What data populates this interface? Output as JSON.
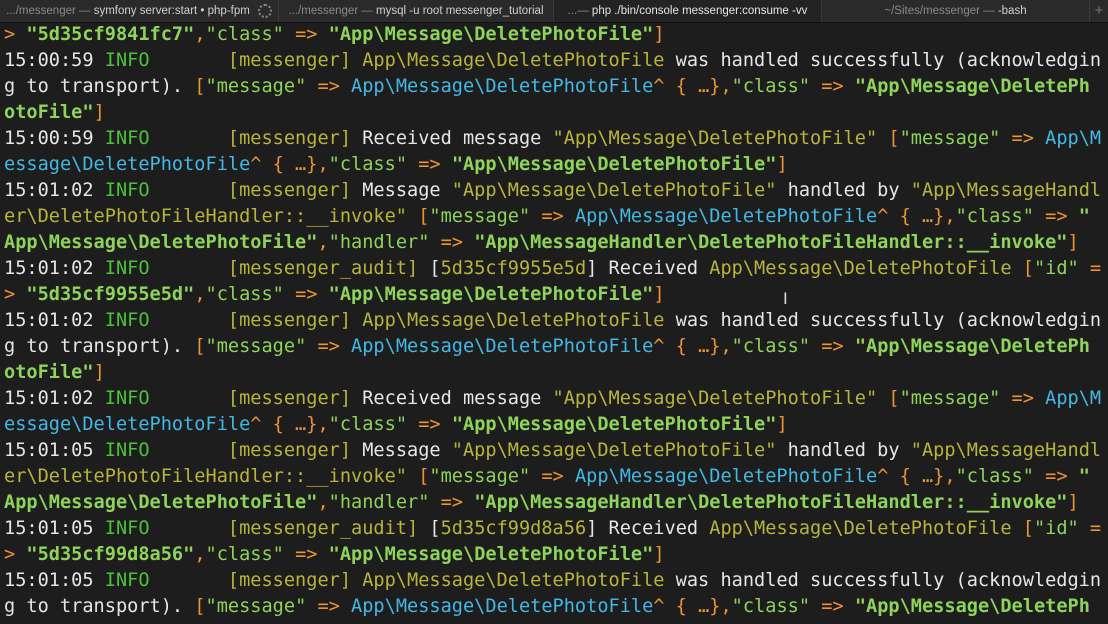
{
  "tabs": [
    {
      "path": ".../messenger — ",
      "cmd": "symfony server:start • php-fpm",
      "busy": true
    },
    {
      "path": ".../messenger — ",
      "cmd": "mysql -u root messenger_tutorial"
    },
    {
      "path": "...— ",
      "cmd": "php ./bin/console messenger:consume -vv",
      "active": true
    },
    {
      "path": "~/Sites/messenger — ",
      "cmd": "-bash"
    }
  ],
  "new_tab_label": "+",
  "colors": {
    "background": "#1d1d1d",
    "info": "#4cc13a",
    "channel": "#b9b43c",
    "punct": "#ec9435",
    "class": "#44b8e4",
    "string": "#8ed35a"
  },
  "lines": [
    [
      [
        "> ",
        "o"
      ],
      [
        "\"5d35cf9841fc7\"",
        "b"
      ],
      [
        ",",
        "o"
      ],
      [
        "\"class\"",
        "l"
      ],
      [
        " => ",
        "o"
      ],
      [
        "\"App\\Message\\DeletePhotoFile\"",
        "b"
      ],
      [
        "]",
        "o"
      ]
    ],
    [
      [
        "15:00:59 ",
        "w"
      ],
      [
        "INFO",
        "g"
      ],
      [
        "       [messenger] App\\Message\\DeletePhotoFile ",
        "y"
      ],
      [
        "was handled successfully (acknowledgin",
        "w"
      ]
    ],
    [
      [
        "g to transport). ",
        "w"
      ],
      [
        "[",
        "o"
      ],
      [
        "\"message\"",
        "l"
      ],
      [
        " => ",
        "o"
      ],
      [
        "App\\Message\\DeletePhotoFile",
        "c"
      ],
      [
        "^ { …},",
        "o"
      ],
      [
        "\"class\"",
        "l"
      ],
      [
        " => ",
        "o"
      ],
      [
        "\"App\\Message\\DeletePh",
        "b"
      ]
    ],
    [
      [
        "otoFile\"",
        "b"
      ],
      [
        "]",
        "o"
      ]
    ],
    [
      [
        "15:00:59 ",
        "w"
      ],
      [
        "INFO",
        "g"
      ],
      [
        "       [messenger] ",
        "y"
      ],
      [
        "Received message ",
        "w"
      ],
      [
        "\"App\\Message\\DeletePhotoFile\" ",
        "y"
      ],
      [
        "[",
        "o"
      ],
      [
        "\"message\"",
        "l"
      ],
      [
        " => ",
        "o"
      ],
      [
        "App\\M",
        "c"
      ]
    ],
    [
      [
        "essage\\DeletePhotoFile",
        "c"
      ],
      [
        "^ { …},",
        "o"
      ],
      [
        "\"class\"",
        "l"
      ],
      [
        " => ",
        "o"
      ],
      [
        "\"App\\Message\\DeletePhotoFile\"",
        "b"
      ],
      [
        "]",
        "o"
      ]
    ],
    [
      [
        "15:01:02 ",
        "w"
      ],
      [
        "INFO",
        "g"
      ],
      [
        "       [messenger] ",
        "y"
      ],
      [
        "Message ",
        "w"
      ],
      [
        "\"App\\Message\\DeletePhotoFile\"",
        "y"
      ],
      [
        " handled by ",
        "w"
      ],
      [
        "\"App\\MessageHandl",
        "y"
      ]
    ],
    [
      [
        "er\\DeletePhotoFileHandler::__invoke\" ",
        "y"
      ],
      [
        "[",
        "o"
      ],
      [
        "\"message\"",
        "l"
      ],
      [
        " => ",
        "o"
      ],
      [
        "App\\Message\\DeletePhotoFile",
        "c"
      ],
      [
        "^ { …},",
        "o"
      ],
      [
        "\"class\"",
        "l"
      ],
      [
        " => ",
        "o"
      ],
      [
        "\"",
        "b"
      ]
    ],
    [
      [
        "App\\Message\\DeletePhotoFile\"",
        "b"
      ],
      [
        ",",
        "o"
      ],
      [
        "\"handler\"",
        "l"
      ],
      [
        " => ",
        "o"
      ],
      [
        "\"App\\MessageHandler\\DeletePhotoFileHandler::__invoke\"",
        "b"
      ],
      [
        "]",
        "o"
      ]
    ],
    [
      [
        "15:01:02 ",
        "w"
      ],
      [
        "INFO",
        "g"
      ],
      [
        "       [messenger_audit] ",
        "y"
      ],
      [
        "[",
        "w"
      ],
      [
        "5d35cf9955e5d",
        "y"
      ],
      [
        "] Received ",
        "w"
      ],
      [
        "App\\Message\\DeletePhotoFile ",
        "y"
      ],
      [
        "[",
        "o"
      ],
      [
        "\"id\"",
        "l"
      ],
      [
        " =",
        "o"
      ]
    ],
    [
      [
        "> ",
        "o"
      ],
      [
        "\"5d35cf9955e5d\"",
        "b"
      ],
      [
        ",",
        "o"
      ],
      [
        "\"class\"",
        "l"
      ],
      [
        " => ",
        "o"
      ],
      [
        "\"App\\Message\\DeletePhotoFile\"",
        "b"
      ],
      [
        "]",
        "o"
      ]
    ],
    [
      [
        "15:01:02 ",
        "w"
      ],
      [
        "INFO",
        "g"
      ],
      [
        "       [messenger] App\\Message\\DeletePhotoFile ",
        "y"
      ],
      [
        "was handled successfully (acknowledgin",
        "w"
      ]
    ],
    [
      [
        "g to transport). ",
        "w"
      ],
      [
        "[",
        "o"
      ],
      [
        "\"message\"",
        "l"
      ],
      [
        " => ",
        "o"
      ],
      [
        "App\\Message\\DeletePhotoFile",
        "c"
      ],
      [
        "^ { …},",
        "o"
      ],
      [
        "\"class\"",
        "l"
      ],
      [
        " => ",
        "o"
      ],
      [
        "\"App\\Message\\DeletePh",
        "b"
      ]
    ],
    [
      [
        "otoFile\"",
        "b"
      ],
      [
        "]",
        "o"
      ]
    ],
    [
      [
        "15:01:02 ",
        "w"
      ],
      [
        "INFO",
        "g"
      ],
      [
        "       [messenger] ",
        "y"
      ],
      [
        "Received message ",
        "w"
      ],
      [
        "\"App\\Message\\DeletePhotoFile\" ",
        "y"
      ],
      [
        "[",
        "o"
      ],
      [
        "\"message\"",
        "l"
      ],
      [
        " => ",
        "o"
      ],
      [
        "App\\M",
        "c"
      ]
    ],
    [
      [
        "essage\\DeletePhotoFile",
        "c"
      ],
      [
        "^ { …},",
        "o"
      ],
      [
        "\"class\"",
        "l"
      ],
      [
        " => ",
        "o"
      ],
      [
        "\"App\\Message\\DeletePhotoFile\"",
        "b"
      ],
      [
        "]",
        "o"
      ]
    ],
    [
      [
        "15:01:05 ",
        "w"
      ],
      [
        "INFO",
        "g"
      ],
      [
        "       [messenger] ",
        "y"
      ],
      [
        "Message ",
        "w"
      ],
      [
        "\"App\\Message\\DeletePhotoFile\"",
        "y"
      ],
      [
        " handled by ",
        "w"
      ],
      [
        "\"App\\MessageHandl",
        "y"
      ]
    ],
    [
      [
        "er\\DeletePhotoFileHandler::__invoke\" ",
        "y"
      ],
      [
        "[",
        "o"
      ],
      [
        "\"message\"",
        "l"
      ],
      [
        " => ",
        "o"
      ],
      [
        "App\\Message\\DeletePhotoFile",
        "c"
      ],
      [
        "^ { …},",
        "o"
      ],
      [
        "\"class\"",
        "l"
      ],
      [
        " => ",
        "o"
      ],
      [
        "\"",
        "b"
      ]
    ],
    [
      [
        "App\\Message\\DeletePhotoFile\"",
        "b"
      ],
      [
        ",",
        "o"
      ],
      [
        "\"handler\"",
        "l"
      ],
      [
        " => ",
        "o"
      ],
      [
        "\"App\\MessageHandler\\DeletePhotoFileHandler::__invoke\"",
        "b"
      ],
      [
        "]",
        "o"
      ]
    ],
    [
      [
        "15:01:05 ",
        "w"
      ],
      [
        "INFO",
        "g"
      ],
      [
        "       [messenger_audit] ",
        "y"
      ],
      [
        "[",
        "w"
      ],
      [
        "5d35cf99d8a56",
        "y"
      ],
      [
        "] Received ",
        "w"
      ],
      [
        "App\\Message\\DeletePhotoFile ",
        "y"
      ],
      [
        "[",
        "o"
      ],
      [
        "\"id\"",
        "l"
      ],
      [
        " =",
        "o"
      ]
    ],
    [
      [
        "> ",
        "o"
      ],
      [
        "\"5d35cf99d8a56\"",
        "b"
      ],
      [
        ",",
        "o"
      ],
      [
        "\"class\"",
        "l"
      ],
      [
        " => ",
        "o"
      ],
      [
        "\"App\\Message\\DeletePhotoFile\"",
        "b"
      ],
      [
        "]",
        "o"
      ]
    ],
    [
      [
        "15:01:05 ",
        "w"
      ],
      [
        "INFO",
        "g"
      ],
      [
        "       [messenger] App\\Message\\DeletePhotoFile ",
        "y"
      ],
      [
        "was handled successfully (acknowledgin",
        "w"
      ]
    ],
    [
      [
        "g to transport). ",
        "w"
      ],
      [
        "[",
        "o"
      ],
      [
        "\"message\"",
        "l"
      ],
      [
        " => ",
        "o"
      ],
      [
        "App\\Message\\DeletePhotoFile",
        "c"
      ],
      [
        "^ { …},",
        "o"
      ],
      [
        "\"class\"",
        "l"
      ],
      [
        " => ",
        "o"
      ],
      [
        "\"App\\Message\\DeletePh",
        "b"
      ]
    ]
  ]
}
